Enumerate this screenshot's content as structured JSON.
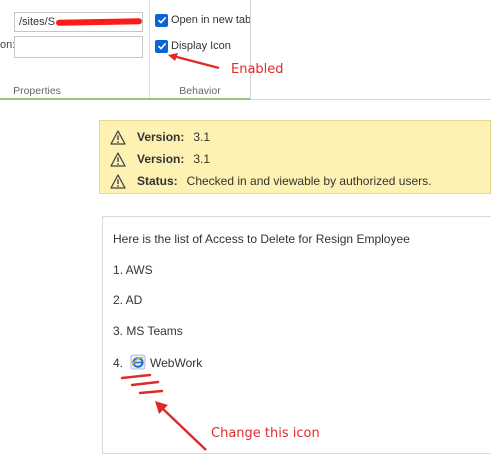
{
  "ribbon": {
    "url_value": "/sites/S",
    "description_label": "on:",
    "open_in_new_tab_label": "Open in new tab",
    "display_icon_label": "Display Icon",
    "open_in_new_tab_checked": true,
    "display_icon_checked": true,
    "group_properties": "Properties",
    "group_behavior": "Behavior"
  },
  "annotations": {
    "enabled": "Enabled",
    "change_icon": "Change this icon",
    "color": "#e02a2a"
  },
  "status": {
    "rows": [
      {
        "key": "Version:",
        "value": "3.1"
      },
      {
        "key": "Version:",
        "value": "3.1"
      },
      {
        "key": "Status:",
        "value": "Checked in and viewable by authorized users."
      }
    ],
    "icon": "warning-triangle-icon"
  },
  "content": {
    "intro": "Here is the list of Access to Delete for Resign Employee",
    "items": [
      "1. AWS",
      "2. AD",
      "3. MS Teams"
    ],
    "item4_number": "4.",
    "item4_label": "WebWork",
    "item4_icon": "internet-explorer-icon"
  },
  "colors": {
    "checkbox": "#0a66d6",
    "status_bg": "#fdf2b1",
    "annotation_red": "#e02a2a"
  }
}
